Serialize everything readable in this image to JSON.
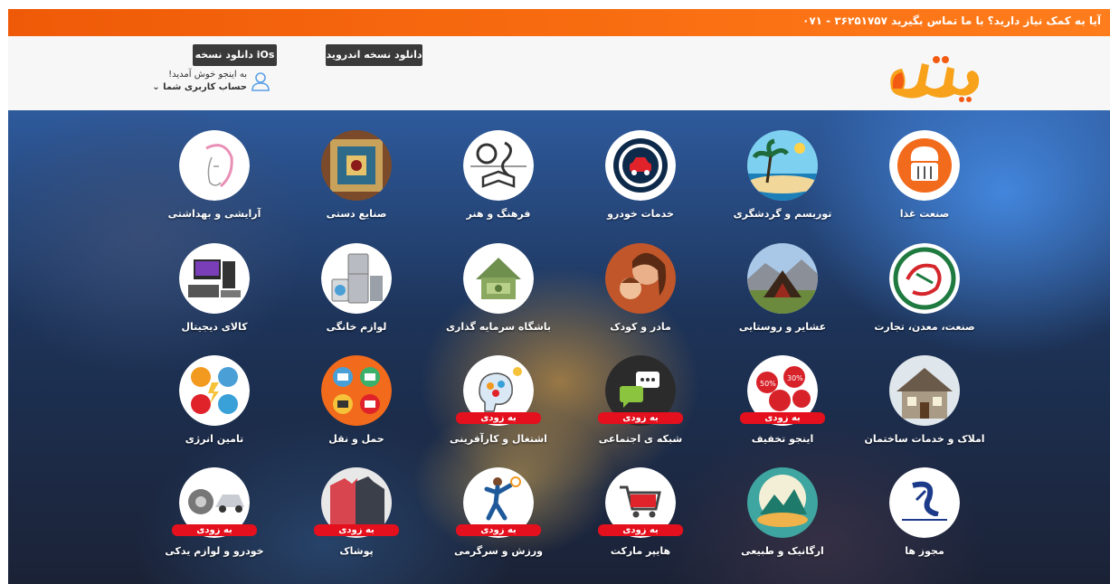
{
  "topbar": {
    "help_text": "آیا به کمک نیاز دارید؟ با ما تماس بگیرید ۳۶۲۵۱۷۵۷ - ۰۷۱"
  },
  "header": {
    "logo_text": "اینجو",
    "download_android": "دانلود نسخه اندروید",
    "download_ios": "دانلود نسخه iOs",
    "welcome": "به اینجو خوش آمدید!",
    "account": "حساب کاربری شما ⌄"
  },
  "categories": [
    {
      "label": "صنعت غذا",
      "icon": "food-industry-icon",
      "soon": ""
    },
    {
      "label": "توریسم و گردشگری",
      "icon": "tourism-icon",
      "soon": ""
    },
    {
      "label": "خدمات خودرو",
      "icon": "car-service-icon",
      "soon": ""
    },
    {
      "label": "فرهنگ و هنر",
      "icon": "culture-art-icon",
      "soon": ""
    },
    {
      "label": "صنایع دستی",
      "icon": "handicrafts-icon",
      "soon": ""
    },
    {
      "label": "آرایشی و بهداشتی",
      "icon": "cosmetics-icon",
      "soon": ""
    },
    {
      "label": "صنعت، معدن، تجارت",
      "icon": "industry-mine-trade-icon",
      "soon": ""
    },
    {
      "label": "عشایر و روستایی",
      "icon": "nomads-rural-icon",
      "soon": ""
    },
    {
      "label": "مادر و کودک",
      "icon": "mother-child-icon",
      "soon": ""
    },
    {
      "label": "باشگاه سرمایه گذاری",
      "icon": "investment-club-icon",
      "soon": ""
    },
    {
      "label": "لوازم خانگی",
      "icon": "home-appliances-icon",
      "soon": ""
    },
    {
      "label": "کالای دیجیتال",
      "icon": "digital-goods-icon",
      "soon": ""
    },
    {
      "label": "املاک و خدمات ساختمان",
      "icon": "real-estate-icon",
      "soon": ""
    },
    {
      "label": "اینجو تخفیف",
      "icon": "discount-icon",
      "soon": "به زودی"
    },
    {
      "label": "شبکه ی اجتماعی",
      "icon": "social-network-icon",
      "soon": "به زودی"
    },
    {
      "label": "اشتغال و کارآفرینی",
      "icon": "employment-icon",
      "soon": "به زودی"
    },
    {
      "label": "حمل و نقل",
      "icon": "transport-icon",
      "soon": ""
    },
    {
      "label": "تامین انرژی",
      "icon": "energy-supply-icon",
      "soon": ""
    },
    {
      "label": "مجوز ها",
      "icon": "licenses-icon",
      "soon": ""
    },
    {
      "label": "ارگانیک و طبیعی",
      "icon": "organic-natural-icon",
      "soon": ""
    },
    {
      "label": "هایپر مارکت",
      "icon": "hypermarket-icon",
      "soon": "به زودی"
    },
    {
      "label": "ورزش و سرگرمی",
      "icon": "sport-icon",
      "soon": "به زودی"
    },
    {
      "label": "پوشاک",
      "icon": "clothing-icon",
      "soon": "به زودی"
    },
    {
      "label": "خودرو و لوازم یدکی",
      "icon": "auto-parts-icon",
      "soon": "به زودی"
    }
  ],
  "colors": {
    "brand_orange": "#f86b10",
    "badge_red": "#e4101d",
    "button_dark": "#3a3a3a"
  }
}
